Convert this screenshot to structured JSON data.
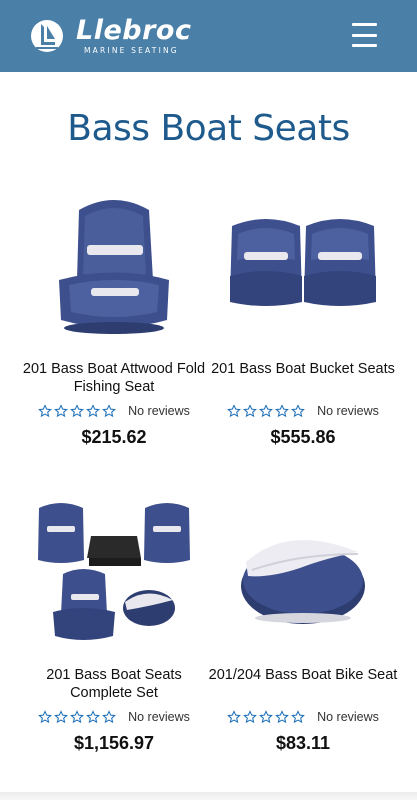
{
  "header": {
    "brand_name": "Llebroc",
    "brand_tagline": "MARINE SEATING",
    "menu_icon": "hamburger-icon",
    "background_color": "#4a7fa8"
  },
  "page": {
    "title": "Bass Boat Seats",
    "title_color": "#1f5a8c"
  },
  "products": [
    {
      "title": "201 Bass Boat Attwood Fold Fishing Seat",
      "reviews": "No reviews",
      "price": "$215.62",
      "rating": 0,
      "image_icon": "folding-seat-image"
    },
    {
      "title": "201 Bass Boat Bucket Seats",
      "reviews": "No reviews",
      "price": "$555.86",
      "rating": 0,
      "image_icon": "bucket-seats-image"
    },
    {
      "title": "201 Bass Boat Seats Complete Set",
      "reviews": "No reviews",
      "price": "$1,156.97",
      "rating": 0,
      "image_icon": "complete-set-image"
    },
    {
      "title": "201/204 Bass Boat Bike Seat",
      "reviews": "No reviews",
      "price": "$83.11",
      "rating": 0,
      "image_icon": "bike-seat-image"
    }
  ],
  "colors": {
    "seat_blue": "#3d4f8c",
    "seat_white": "#e8e8ee",
    "star_blue": "#1e6fb8"
  }
}
